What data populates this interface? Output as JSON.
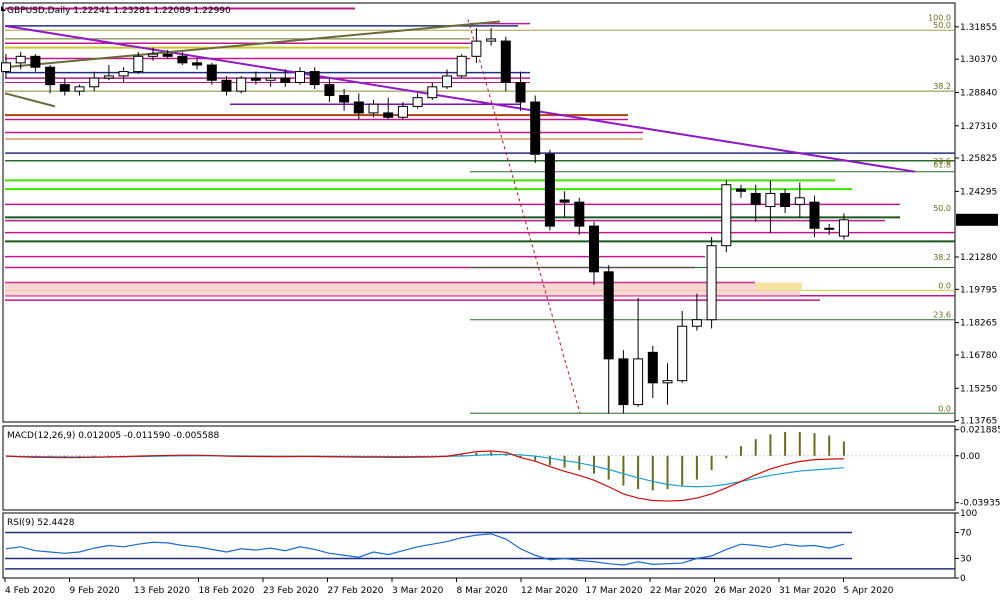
{
  "chart_data": [
    {
      "type": "candlestick",
      "header": "GBPUSD,Daily  1.22241 1.23281 1.22089 1.22990",
      "current_price_label": "1.22990",
      "ylim": [
        1.137,
        1.3295
      ],
      "y_ticks": [
        {
          "v": 1.31855,
          "label": "1.31855"
        },
        {
          "v": 1.3037,
          "label": "1.30370"
        },
        {
          "v": 1.2884,
          "label": "1.28840"
        },
        {
          "v": 1.2731,
          "label": "1.27310"
        },
        {
          "v": 1.25825,
          "label": "1.25825"
        },
        {
          "v": 1.24295,
          "label": "1.24295"
        },
        {
          "v": 1.2299,
          "label": "1.22990"
        },
        {
          "v": 1.2128,
          "label": "1.21280"
        },
        {
          "v": 1.19795,
          "label": "1.19795"
        },
        {
          "v": 1.18265,
          "label": "1.18265"
        },
        {
          "v": 1.1678,
          "label": "1.16780"
        },
        {
          "v": 1.1525,
          "label": "1.15250"
        },
        {
          "v": 1.13765,
          "label": "1.13765"
        }
      ],
      "candles": [
        {
          "o": 1.298,
          "h": 1.306,
          "l": 1.295,
          "c": 1.302
        },
        {
          "o": 1.302,
          "h": 1.307,
          "l": 1.299,
          "c": 1.305
        },
        {
          "o": 1.305,
          "h": 1.306,
          "l": 1.298,
          "c": 1.3
        },
        {
          "o": 1.3,
          "h": 1.301,
          "l": 1.288,
          "c": 1.292
        },
        {
          "o": 1.292,
          "h": 1.295,
          "l": 1.287,
          "c": 1.289
        },
        {
          "o": 1.289,
          "h": 1.292,
          "l": 1.287,
          "c": 1.291
        },
        {
          "o": 1.291,
          "h": 1.298,
          "l": 1.289,
          "c": 1.295
        },
        {
          "o": 1.295,
          "h": 1.301,
          "l": 1.294,
          "c": 1.296
        },
        {
          "o": 1.296,
          "h": 1.3,
          "l": 1.293,
          "c": 1.298
        },
        {
          "o": 1.298,
          "h": 1.307,
          "l": 1.297,
          "c": 1.305
        },
        {
          "o": 1.305,
          "h": 1.309,
          "l": 1.303,
          "c": 1.306
        },
        {
          "o": 1.306,
          "h": 1.308,
          "l": 1.304,
          "c": 1.305
        },
        {
          "o": 1.305,
          "h": 1.307,
          "l": 1.301,
          "c": 1.302
        },
        {
          "o": 1.302,
          "h": 1.304,
          "l": 1.299,
          "c": 1.301
        },
        {
          "o": 1.301,
          "h": 1.302,
          "l": 1.292,
          "c": 1.294
        },
        {
          "o": 1.294,
          "h": 1.296,
          "l": 1.287,
          "c": 1.289
        },
        {
          "o": 1.289,
          "h": 1.296,
          "l": 1.288,
          "c": 1.295
        },
        {
          "o": 1.295,
          "h": 1.298,
          "l": 1.292,
          "c": 1.294
        },
        {
          "o": 1.294,
          "h": 1.297,
          "l": 1.291,
          "c": 1.295
        },
        {
          "o": 1.295,
          "h": 1.299,
          "l": 1.291,
          "c": 1.293
        },
        {
          "o": 1.293,
          "h": 1.3,
          "l": 1.292,
          "c": 1.298
        },
        {
          "o": 1.298,
          "h": 1.3,
          "l": 1.29,
          "c": 1.292
        },
        {
          "o": 1.292,
          "h": 1.295,
          "l": 1.284,
          "c": 1.287
        },
        {
          "o": 1.287,
          "h": 1.29,
          "l": 1.28,
          "c": 1.284
        },
        {
          "o": 1.284,
          "h": 1.288,
          "l": 1.276,
          "c": 1.279
        },
        {
          "o": 1.279,
          "h": 1.285,
          "l": 1.277,
          "c": 1.283
        },
        {
          "o": 1.279,
          "h": 1.286,
          "l": 1.276,
          "c": 1.277
        },
        {
          "o": 1.277,
          "h": 1.284,
          "l": 1.276,
          "c": 1.282
        },
        {
          "o": 1.282,
          "h": 1.288,
          "l": 1.281,
          "c": 1.286
        },
        {
          "o": 1.286,
          "h": 1.293,
          "l": 1.285,
          "c": 1.291
        },
        {
          "o": 1.291,
          "h": 1.299,
          "l": 1.29,
          "c": 1.296
        },
        {
          "o": 1.296,
          "h": 1.306,
          "l": 1.295,
          "c": 1.305
        },
        {
          "o": 1.305,
          "h": 1.318,
          "l": 1.302,
          "c": 1.312
        },
        {
          "o": 1.312,
          "h": 1.318,
          "l": 1.31,
          "c": 1.313
        },
        {
          "o": 1.312,
          "h": 1.314,
          "l": 1.289,
          "c": 1.293
        },
        {
          "o": 1.293,
          "h": 1.298,
          "l": 1.28,
          "c": 1.284
        },
        {
          "o": 1.284,
          "h": 1.287,
          "l": 1.256,
          "c": 1.26
        },
        {
          "o": 1.26,
          "h": 1.262,
          "l": 1.225,
          "c": 1.227
        },
        {
          "o": 1.239,
          "h": 1.243,
          "l": 1.231,
          "c": 1.238
        },
        {
          "o": 1.238,
          "h": 1.24,
          "l": 1.223,
          "c": 1.227
        },
        {
          "o": 1.227,
          "h": 1.229,
          "l": 1.2,
          "c": 1.206
        },
        {
          "o": 1.206,
          "h": 1.209,
          "l": 1.1409,
          "c": 1.166
        },
        {
          "o": 1.166,
          "h": 1.17,
          "l": 1.1409,
          "c": 1.145
        },
        {
          "o": 1.145,
          "h": 1.194,
          "l": 1.144,
          "c": 1.166
        },
        {
          "o": 1.169,
          "h": 1.172,
          "l": 1.148,
          "c": 1.155
        },
        {
          "o": 1.155,
          "h": 1.164,
          "l": 1.145,
          "c": 1.156
        },
        {
          "o": 1.156,
          "h": 1.188,
          "l": 1.155,
          "c": 1.181
        },
        {
          "o": 1.181,
          "h": 1.196,
          "l": 1.179,
          "c": 1.184
        },
        {
          "o": 1.184,
          "h": 1.222,
          "l": 1.18,
          "c": 1.218
        },
        {
          "o": 1.218,
          "h": 1.248,
          "l": 1.215,
          "c": 1.246
        },
        {
          "o": 1.244,
          "h": 1.246,
          "l": 1.24,
          "c": 1.243
        },
        {
          "o": 1.242,
          "h": 1.246,
          "l": 1.229,
          "c": 1.237
        },
        {
          "o": 1.236,
          "h": 1.248,
          "l": 1.224,
          "c": 1.242
        },
        {
          "o": 1.242,
          "h": 1.244,
          "l": 1.233,
          "c": 1.236
        },
        {
          "o": 1.237,
          "h": 1.247,
          "l": 1.231,
          "c": 1.24
        },
        {
          "o": 1.238,
          "h": 1.241,
          "l": 1.222,
          "c": 1.226
        },
        {
          "o": 1.226,
          "h": 1.228,
          "l": 1.223,
          "c": 1.226
        },
        {
          "o": 1.2224,
          "h": 1.2328,
          "l": 1.2209,
          "c": 1.2299
        }
      ],
      "fib_labels": [
        {
          "v": 1.3205,
          "label": "100.0"
        },
        {
          "v": 1.317,
          "label": "50.0"
        },
        {
          "v": 1.289,
          "label": "38.2"
        },
        {
          "v": 1.2545,
          "label": "23.6"
        },
        {
          "v": 1.253,
          "label": "61.8"
        },
        {
          "v": 1.233,
          "label": "50.0"
        },
        {
          "v": 1.2105,
          "label": "38.2"
        },
        {
          "v": 1.1975,
          "label": "0.0"
        },
        {
          "v": 1.184,
          "label": "23.6"
        },
        {
          "v": 1.141,
          "label": "0.0"
        }
      ],
      "x_labels": [
        "4 Feb 2020",
        "9 Feb 2020",
        "13 Feb 2020",
        "18 Feb 2020",
        "23 Feb 2020",
        "27 Feb 2020",
        "3 Mar 2020",
        "8 Mar 2020",
        "12 Mar 2020",
        "17 Mar 2020",
        "22 Mar 2020",
        "26 Mar 2020",
        "31 Mar 2020",
        "5 Apr 2020"
      ]
    },
    {
      "type": "bar+line",
      "header": "MACD(12,26,9) 0.012005 -0.011590 -0.005588",
      "ylim": [
        -0.0455,
        0.025
      ],
      "y_ticks": [
        {
          "v": 0.021885,
          "label": "0.021885"
        },
        {
          "v": 0.0,
          "label": "0.00"
        },
        {
          "v": -0.039351,
          "label": "-0.039351"
        }
      ],
      "histogram": [
        0.0,
        0.0,
        -0.0006,
        -0.0008,
        -0.001,
        -0.001,
        -0.0008,
        -0.0006,
        -0.0005,
        -0.0002,
        0.0,
        0.0003,
        0.0004,
        0.0004,
        0.0002,
        -0.0002,
        -0.0003,
        -0.0004,
        -0.0005,
        -0.0005,
        -0.0004,
        -0.0004,
        -0.0005,
        -0.0006,
        -0.0007,
        -0.0007,
        -0.0008,
        -0.0008,
        -0.0007,
        -0.0006,
        -0.0002,
        0.001,
        0.0025,
        0.003,
        0.002,
        -0.001,
        -0.004,
        -0.008,
        -0.01,
        -0.012,
        -0.015,
        -0.02,
        -0.025,
        -0.028,
        -0.029,
        -0.028,
        -0.025,
        -0.02,
        -0.012,
        -0.002,
        0.008,
        0.014,
        0.018,
        0.02,
        0.02,
        0.019,
        0.017,
        0.012
      ],
      "signal": [
        -0.0005,
        -0.0006,
        -0.0007,
        -0.0008,
        -0.0009,
        -0.001,
        -0.001,
        -0.0009,
        -0.0008,
        -0.0006,
        -0.0004,
        -0.0002,
        0.0,
        0.0,
        0.0,
        -0.0001,
        -0.0002,
        -0.0003,
        -0.0004,
        -0.0004,
        -0.0004,
        -0.0004,
        -0.0005,
        -0.0005,
        -0.0006,
        -0.0006,
        -0.0007,
        -0.0007,
        -0.0007,
        -0.0006,
        -0.0004,
        -0.0002,
        0.0004,
        0.001,
        0.0012,
        0.0008,
        -0.0003,
        -0.002,
        -0.004,
        -0.006,
        -0.0085,
        -0.0115,
        -0.015,
        -0.0185,
        -0.0215,
        -0.024,
        -0.0255,
        -0.026,
        -0.0255,
        -0.024,
        -0.0215,
        -0.019,
        -0.0165,
        -0.0145,
        -0.0128,
        -0.0118,
        -0.011,
        -0.01
      ],
      "macd": [
        -0.0002,
        -0.0008,
        -0.0012,
        -0.0014,
        -0.0016,
        -0.0015,
        -0.0013,
        -0.001,
        -0.0007,
        -0.0003,
        0.0,
        0.0003,
        0.0005,
        0.0005,
        0.0002,
        -0.0003,
        -0.0005,
        -0.0006,
        -0.0007,
        -0.0007,
        -0.0006,
        -0.0006,
        -0.0008,
        -0.0009,
        -0.0011,
        -0.0011,
        -0.0012,
        -0.0012,
        -0.0011,
        -0.0009,
        -0.0004,
        0.0015,
        0.0035,
        0.004,
        0.003,
        -0.0015,
        -0.0045,
        -0.009,
        -0.013,
        -0.0165,
        -0.0205,
        -0.026,
        -0.032,
        -0.0355,
        -0.0375,
        -0.038,
        -0.0375,
        -0.0355,
        -0.032,
        -0.027,
        -0.0215,
        -0.016,
        -0.011,
        -0.0075,
        -0.0048,
        -0.0032,
        -0.0028,
        -0.0025
      ]
    },
    {
      "type": "line",
      "header": "RSI(9) 52.4428",
      "ylim": [
        0,
        100
      ],
      "y_ticks": [
        {
          "v": 100,
          "label": "100"
        },
        {
          "v": 70,
          "label": "70"
        },
        {
          "v": 30,
          "label": "30"
        },
        {
          "v": 0,
          "label": "0"
        }
      ],
      "levels": [
        70,
        30
      ],
      "values": [
        45,
        48,
        42,
        40,
        38,
        40,
        46,
        50,
        48,
        52,
        55,
        54,
        50,
        48,
        44,
        40,
        45,
        43,
        46,
        42,
        48,
        44,
        38,
        35,
        32,
        40,
        36,
        42,
        48,
        52,
        56,
        62,
        66,
        68,
        60,
        45,
        35,
        28,
        30,
        27,
        25,
        22,
        20,
        25,
        21,
        22,
        23,
        30,
        34,
        44,
        52,
        50,
        47,
        52,
        49,
        50,
        46,
        52
      ]
    }
  ]
}
